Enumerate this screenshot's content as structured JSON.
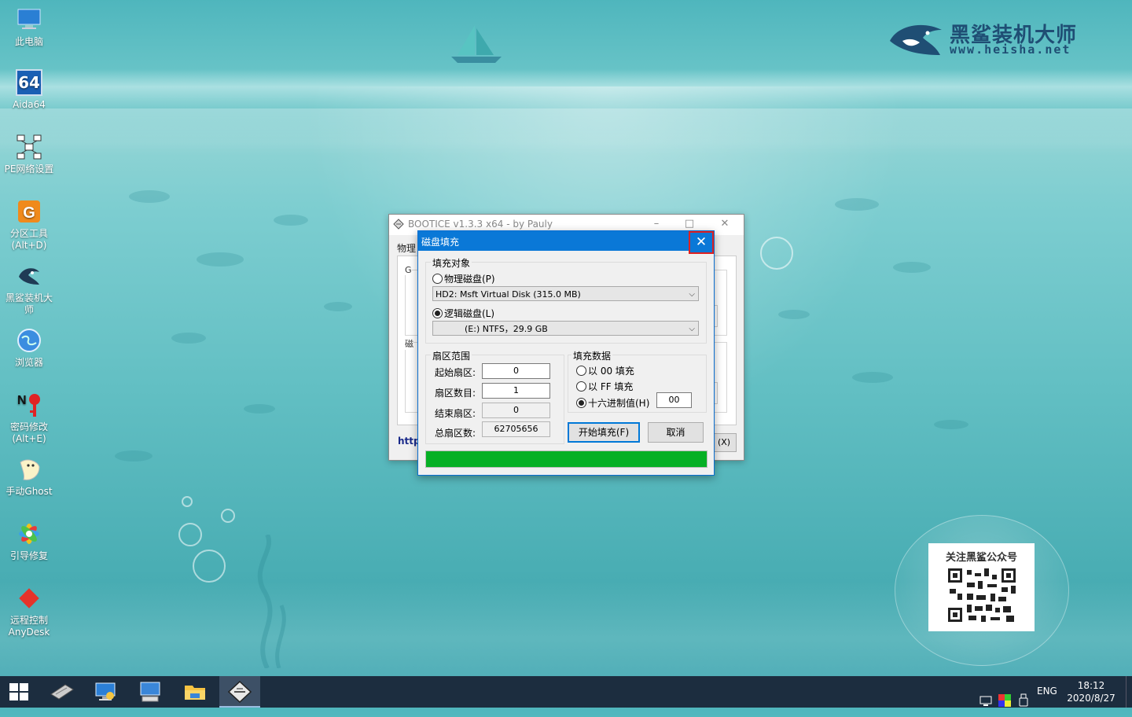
{
  "desktop": {
    "icons": [
      {
        "label": "此电脑",
        "icon": "computer-icon"
      },
      {
        "label": "Aida64",
        "icon": "aida64-icon"
      },
      {
        "label": "PE网络设置",
        "icon": "network-icon"
      },
      {
        "label": "分区工具\n(Alt+D)",
        "icon": "partition-icon"
      },
      {
        "label": "黑鲨装机大\n师",
        "icon": "heisha-icon"
      },
      {
        "label": "浏览器",
        "icon": "browser-icon"
      },
      {
        "label": "密码修改\n(Alt+E)",
        "icon": "password-icon"
      },
      {
        "label": "手动Ghost",
        "icon": "ghost-icon"
      },
      {
        "label": "引导修复",
        "icon": "boot-repair-icon"
      },
      {
        "label": "远程控制\nAnyDesk",
        "icon": "anydesk-icon"
      }
    ],
    "aida_badge": "64"
  },
  "logo": {
    "name": "黑鲨装机大师",
    "url": "www.heisha.net"
  },
  "qr": {
    "title": "关注黑鲨公众号"
  },
  "bootice": {
    "title": "BOOTICE v1.3.3 x64 - by Pauly",
    "tab": "物理",
    "link": "http",
    "exit_button": "(X)",
    "grp1_letter": "G",
    "grp2_letter": "磁"
  },
  "dialog": {
    "title": "磁盘填充",
    "fill_target": {
      "legend": "填充对象",
      "physical_label": "物理磁盘(P)",
      "physical_selected": false,
      "physical_value": "HD2: Msft Virtual Disk (315.0 MB)",
      "logical_label": "逻辑磁盘(L)",
      "logical_selected": true,
      "logical_value": "(E:)   NTFS，29.9 GB"
    },
    "sector_range": {
      "legend": "扇区范围",
      "start_label": "起始扇区:",
      "start_value": "0",
      "count_label": "扇区数目:",
      "count_value": "1",
      "end_label": "结束扇区:",
      "end_value": "0",
      "total_label": "总扇区数:",
      "total_value": "62705656"
    },
    "fill_data": {
      "legend": "填充数据",
      "opt_00": "以 00 填充",
      "opt_ff": "以 FF 填充",
      "opt_hex": "十六进制值(H)",
      "selected": "hex",
      "hex_value": "00"
    },
    "start_button": "开始填充(F)",
    "cancel_button": "取消",
    "progress": 1.0,
    "progress_color": "#06b025"
  },
  "taskbar": {
    "items": [
      "start-icon",
      "drive-icon",
      "network-settings-icon",
      "pc-icon",
      "file-explorer-icon",
      "bootice-icon"
    ],
    "active_item": "bootice-icon",
    "language": "ENG",
    "time": "18:12",
    "date": "2020/8/27"
  }
}
